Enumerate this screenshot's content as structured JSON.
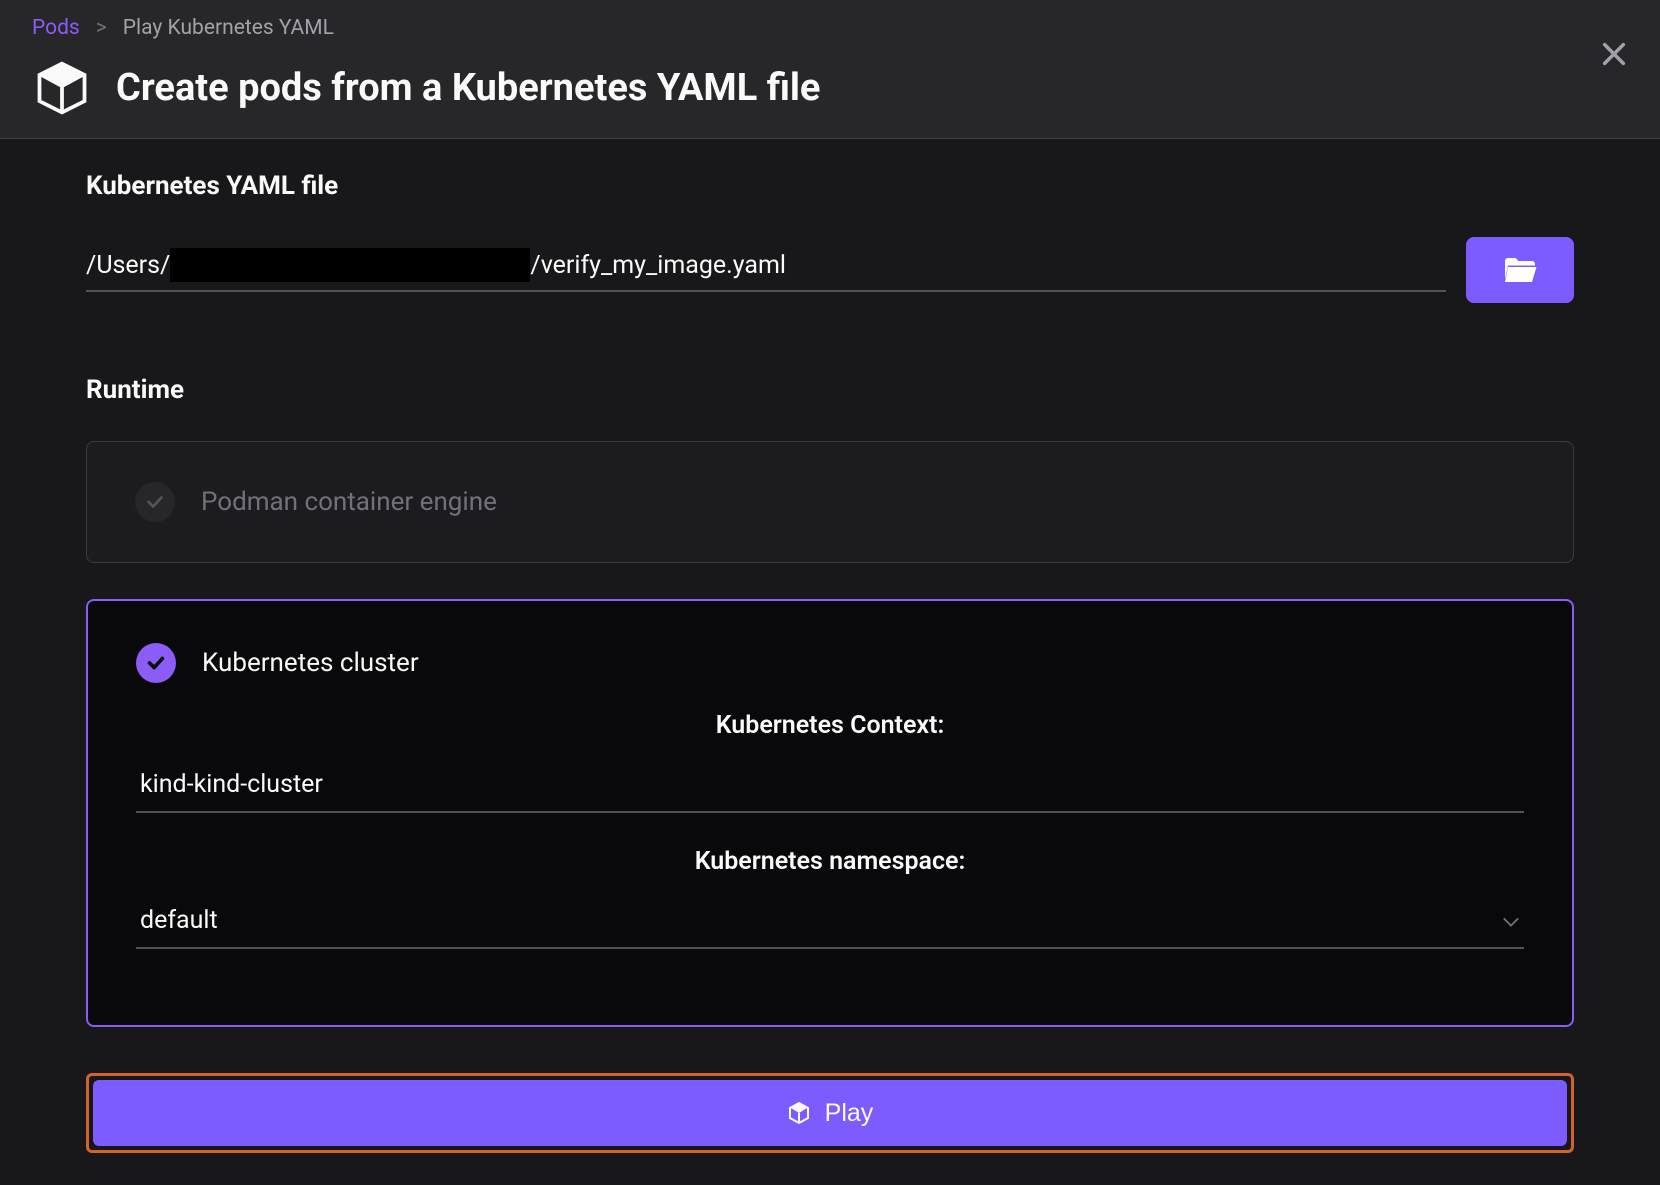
{
  "breadcrumb": {
    "root": "Pods",
    "separator": ">",
    "current": "Play Kubernetes YAML"
  },
  "page": {
    "title": "Create pods from a Kubernetes YAML file"
  },
  "yaml_section": {
    "label": "Kubernetes YAML file",
    "path_prefix": "/Users/",
    "path_suffix": "/verify_my_image.yaml"
  },
  "runtime_section": {
    "label": "Runtime",
    "options": [
      {
        "id": "podman",
        "label": "Podman container engine",
        "selected": false
      },
      {
        "id": "kubernetes",
        "label": "Kubernetes cluster",
        "selected": true,
        "context_label": "Kubernetes Context:",
        "context_value": "kind-kind-cluster",
        "namespace_label": "Kubernetes namespace:",
        "namespace_value": "default"
      }
    ]
  },
  "actions": {
    "play": "Play"
  }
}
